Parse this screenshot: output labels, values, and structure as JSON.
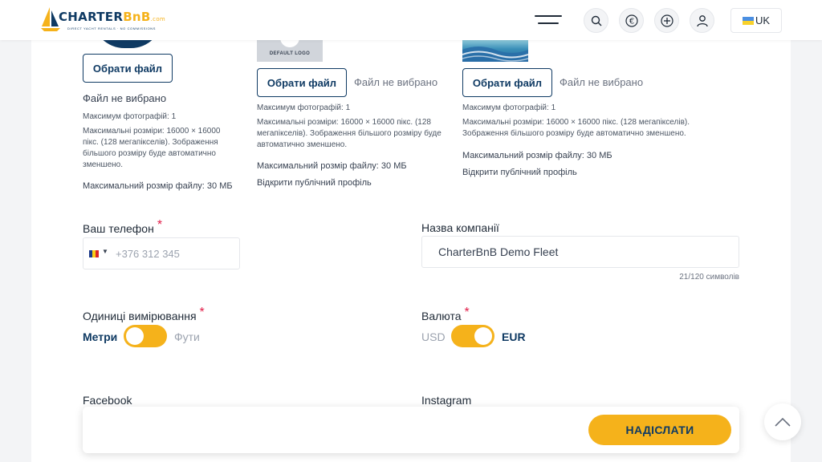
{
  "header": {
    "logo": {
      "brand_main": "CHARTER",
      "brand_accent": "BnB",
      "brand_suffix": ".com",
      "tagline": "DIRECT YACHT RENTALS · NO COMMISSIONS"
    },
    "icons": [
      "menu-icon",
      "search-icon",
      "euro-icon",
      "plus-icon",
      "user-icon"
    ],
    "language": "UK"
  },
  "uploads": [
    {
      "button": "Обрати файл",
      "status": "Файл не вибрано",
      "max_photos": "Максимум фотографій: 1",
      "max_dims": "Максимальні розміри: 16000 × 16000 пікс. (128 мегапікселів). Зображення більшого розміру буде автоматично зменшено.",
      "max_size": "Максимальний розмір файлу: 30 МБ"
    },
    {
      "preview_label": "DEFAULT LOGO",
      "button": "Обрати файл",
      "status": "Файл не вибрано",
      "max_photos": "Максимум фотографій: 1",
      "max_dims": "Максимальні розміри: 16000 × 16000 пікс. (128 мегапікселів). Зображення більшого розміру буде автоматично зменшено.",
      "max_size": "Максимальний розмір файлу: 30 МБ",
      "link": "Відкрити публічний профіль"
    },
    {
      "button": "Обрати файл",
      "status": "Файл не вибрано",
      "max_photos": "Максимум фотографій: 1",
      "max_dims": "Максимальні розміри: 16000 × 16000 пікс. (128 мегапікселів). Зображення більшого розміру буде автоматично зменшено.",
      "max_size": "Максимальний розмір файлу: 30 МБ",
      "link": "Відкрити публічний профіль"
    }
  ],
  "form": {
    "phone_label": "Ваш телефон",
    "phone_placeholder": "+376 312 345",
    "company_label": "Назва компанії",
    "company_value": "CharterBnB Demo Fleet",
    "company_counter": "21/120 символів",
    "units_label": "Одиниці вимірювання",
    "units_left": "Метри",
    "units_right": "Фути",
    "currency_label": "Валюта",
    "currency_left": "USD",
    "currency_right": "EUR",
    "facebook_label": "Facebook",
    "instagram_label": "Instagram",
    "required_mark": "*"
  },
  "actions": {
    "submit": "НАДІСЛАТИ"
  },
  "colors": {
    "accent": "#f5b21b",
    "navy": "#0f3a63",
    "required": "#e11d48"
  }
}
